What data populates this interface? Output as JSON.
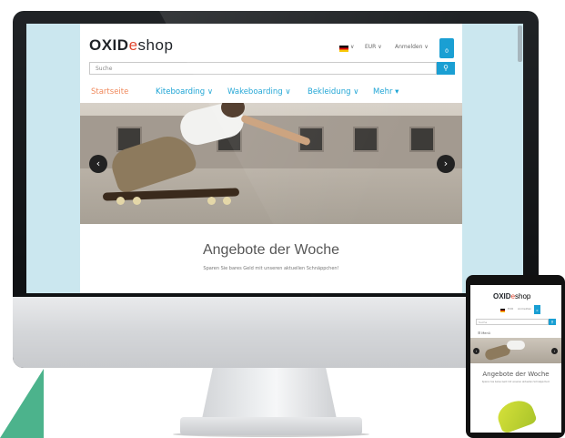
{
  "brand": {
    "oxid": "OXID",
    "e": "e",
    "shop": "shop"
  },
  "header": {
    "language_arrow": "∨",
    "currency": "EUR",
    "login": "Anmelden",
    "cart_count": "0"
  },
  "search": {
    "placeholder": "Suche",
    "button_icon": "search-icon"
  },
  "nav": {
    "items": [
      {
        "label": "Startseite",
        "active": true
      },
      {
        "label": "Kiteboarding",
        "dropdown": true
      },
      {
        "label": "Wakeboarding",
        "dropdown": true
      },
      {
        "label": "Bekleidung",
        "dropdown": true
      },
      {
        "label": "Mehr",
        "dropdown": true
      }
    ]
  },
  "hero": {
    "prev_icon": "chevron-left-icon",
    "next_icon": "chevron-right-icon"
  },
  "offers": {
    "title": "Angebote der Woche",
    "subtitle": "Sparen Sie bares Geld mit unseren aktuellen Schnäppchen!"
  },
  "mobile": {
    "currency": "EUR",
    "login": "Anmelden",
    "cart_count": "0",
    "search_placeholder": "Suche",
    "menu_label": "Menü",
    "title": "Angebote der Woche",
    "subtitle": "Sparen Sie bares Geld mit unseren aktuellen Schnäppchen!"
  },
  "colors": {
    "accent": "#1a9fd3",
    "active_nav": "#f08a5d",
    "logo_e": "#e0462f"
  }
}
